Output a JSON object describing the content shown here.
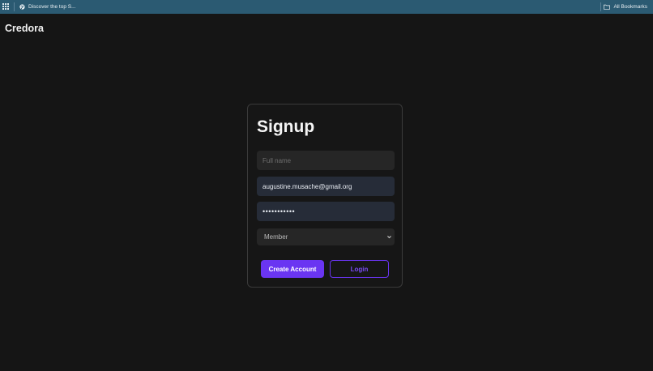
{
  "browser": {
    "bookmark_title": "Discover the top S...",
    "all_bookmarks_label": "All Bookmarks"
  },
  "app": {
    "brand": "Credora"
  },
  "signup": {
    "title": "Signup",
    "full_name_placeholder": "Full name",
    "full_name_value": "",
    "email_value": "augustine.musache@gmail.org",
    "password_value": "•••••••••••",
    "role_selected": "Member",
    "create_account_label": "Create Account",
    "login_label": "Login"
  },
  "colors": {
    "background": "#151515",
    "bookmarks_bar": "#2b5a72",
    "accent": "#6a35f2",
    "input_filled": "#262c38",
    "input_empty": "#262626"
  },
  "icons": {
    "apps": "apps-grid-icon",
    "bookmark": "globe-icon",
    "folder": "folder-icon",
    "select": "chevron-down-icon"
  }
}
